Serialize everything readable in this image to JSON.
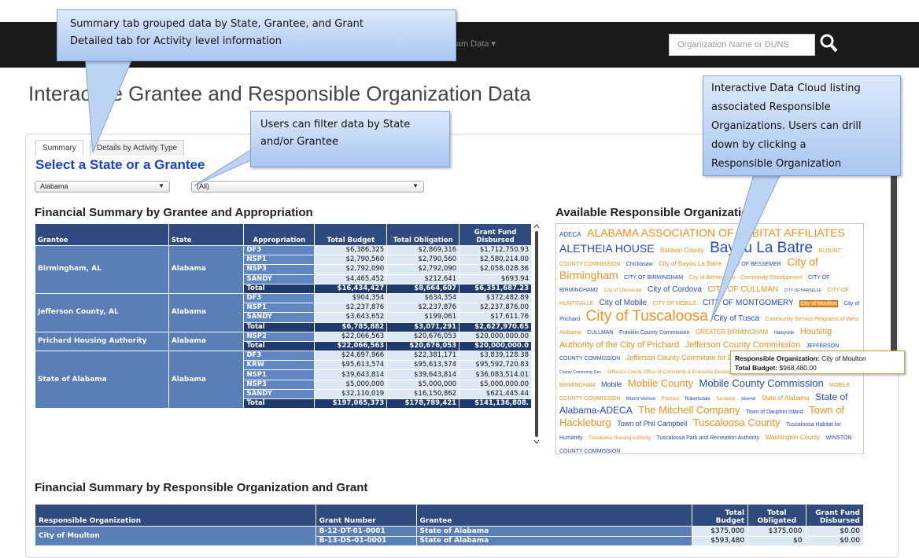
{
  "header": {
    "nav_label": "gram Data",
    "search_placeholder": "Organization Name or DUNS"
  },
  "page_title": "Interactive Grantee and Responsible Organization Data",
  "tabs": [
    {
      "label": "Summary"
    },
    {
      "label": "Details by Activity Type"
    }
  ],
  "select_heading": "Select a State or a Grantee",
  "filters": {
    "state": "Alabama",
    "grantee": "(All)"
  },
  "financial_title": "Financial Summary by Grantee and Appropriation",
  "fin_headers": {
    "grantee": "Grantee",
    "state": "State",
    "appropriation": "Appropriation",
    "total_budget": "Total Budget",
    "total_obligation": "Total Obligation",
    "grant_fund": "Grant Fund Disbursed"
  },
  "fin_rows": [
    {
      "ap": "DF3",
      "tb": "$6,386,325",
      "to": "$2,869,316",
      "gf": "$1,712,750.93"
    },
    {
      "ap": "NSP1",
      "tb": "$2,790,560",
      "to": "$2,790,560",
      "gf": "$2,580,214.00"
    },
    {
      "ap": "NSP3",
      "tb": "$2,792,090",
      "to": "$2,792,090",
      "gf": "$2,058,028.36"
    },
    {
      "ap": "SANDY",
      "tb": "$4,465,452",
      "to": "$212,641",
      "gf": "$693.94"
    },
    {
      "ap": "Total",
      "tb": "$16,434,427",
      "to": "$8,664,607",
      "gf": "$6,351,687.23"
    },
    {
      "ap": "DF3",
      "tb": "$904,354",
      "to": "$634,354",
      "gf": "$372,482.89"
    },
    {
      "ap": "NSP1",
      "tb": "$2,237,876",
      "to": "$2,237,876",
      "gf": "$2,237,876.00"
    },
    {
      "ap": "SANDY",
      "tb": "$3,643,652",
      "to": "$199,061",
      "gf": "$17,611.76"
    },
    {
      "ap": "Total",
      "tb": "$6,785,882",
      "to": "$3,071,291",
      "gf": "$2,627,970.65"
    },
    {
      "ap": "NSP2",
      "tb": "$22,066,563",
      "to": "$20,676,053",
      "gf": "$20,000,000.00"
    },
    {
      "ap": "Total",
      "tb": "$22,066,563",
      "to": "$20,676,053",
      "gf": "$20,000,000.0"
    },
    {
      "ap": "DF3",
      "tb": "$24,697,966",
      "to": "$22,381,171",
      "gf": "$3,839,128.38"
    },
    {
      "ap": "KRW",
      "tb": "$95,613,574",
      "to": "$95,613,574",
      "gf": "$95,592,720.83"
    },
    {
      "ap": "NSP1",
      "tb": "$39,643,814",
      "to": "$39,643,814",
      "gf": "$36,083,514.01"
    },
    {
      "ap": "NSP3",
      "tb": "$5,000,000",
      "to": "$5,000,000",
      "gf": "$5,000,000.00"
    },
    {
      "ap": "SANDY",
      "tb": "$32,110,019",
      "to": "$16,150,862",
      "gf": "$621,445.44"
    },
    {
      "ap": "Total",
      "tb": "$197,065,373",
      "to": "$178,789,421",
      "gf": "$141,136,808."
    }
  ],
  "fin_groups": [
    {
      "grantee": "Birmingham, AL",
      "state": "Alabama"
    },
    {
      "grantee": "Jefferson County, AL",
      "state": "Alabama"
    },
    {
      "grantee": "Prichard Housing Authority",
      "state": "Alabama"
    },
    {
      "grantee": "State of Alabama",
      "state": "Alabama"
    }
  ],
  "cloud_title": "Available Responsible Organizations",
  "cloud_words": [
    {
      "t": "ADECA",
      "s": 8,
      "c": "b"
    },
    {
      "t": "ALABAMA ASSOCIATION OF HABITAT AFFILIATES",
      "s": 14,
      "c": "o"
    },
    {
      "t": "ALETHEIA HOUSE",
      "s": 14,
      "c": "b"
    },
    {
      "t": "Baldwin County",
      "s": 8,
      "c": "o"
    },
    {
      "t": "Bayou La Batre",
      "s": 19,
      "c": "b"
    },
    {
      "t": "BLOUNT COUNTY COMMISSION",
      "s": 7,
      "c": "o"
    },
    {
      "t": "Chickasaw",
      "s": 7,
      "c": "b"
    },
    {
      "t": "City of Bayou La Batre",
      "s": 8,
      "c": "o"
    },
    {
      "t": "CITY OF BESSEMER",
      "s": 7,
      "c": "b"
    },
    {
      "t": "City of Birmingham",
      "s": 14,
      "c": "o"
    },
    {
      "t": "CITY OF BIRMINGHAM",
      "s": 7,
      "c": "b"
    },
    {
      "t": "City of Birmingham - Community Development",
      "s": 7,
      "c": "o"
    },
    {
      "t": "CITY OF BIRMINGHAM2",
      "s": 7,
      "c": "b"
    },
    {
      "t": "City of Chickasaw",
      "s": 6,
      "c": "o"
    },
    {
      "t": "City of Cordova",
      "s": 10,
      "c": "b"
    },
    {
      "t": "CITY OF CULLMAN",
      "s": 10,
      "c": "o"
    },
    {
      "t": "CITY OF HARSELLE",
      "s": 5,
      "c": "b"
    },
    {
      "t": "CITY OF HUNTSVILLE",
      "s": 7,
      "c": "o"
    },
    {
      "t": "City of Mobile",
      "s": 10,
      "c": "b"
    },
    {
      "t": "CITY OF MOBILE",
      "s": 7,
      "c": "o"
    },
    {
      "t": "CITY OF MONTGOMERY",
      "s": 10,
      "c": "b"
    },
    {
      "t": "City of Moulton",
      "s": 7,
      "c": "hl"
    },
    {
      "t": "City of Prichard",
      "s": 7,
      "c": "b"
    },
    {
      "t": "City of Tuscaloosa",
      "s": 19,
      "c": "o"
    },
    {
      "t": "City of Tusca",
      "s": 10,
      "c": "b"
    },
    {
      "t": "Community Service Programs of West Alabama",
      "s": 7,
      "c": "o"
    },
    {
      "t": "CULLMAN",
      "s": 7,
      "c": "b"
    },
    {
      "t": "Franklin County Commission",
      "s": 7,
      "c": "b"
    },
    {
      "t": "GREATER BIRMINGHAM",
      "s": 8,
      "c": "o"
    },
    {
      "t": "Haleyville",
      "s": 6,
      "c": "b"
    },
    {
      "t": "Housing Authority of the City of Prichard",
      "s": 11,
      "c": "o"
    },
    {
      "t": "Jefferson County Commission",
      "s": 11,
      "c": "o"
    },
    {
      "t": "JEFFERSON COUNTY COMMISSION",
      "s": 7,
      "c": "b"
    },
    {
      "t": "Jefferson County Committee for Economic Opportunity (JCCEO)",
      "s": 9,
      "c": "o"
    },
    {
      "t": "Jefferson County Community Dev",
      "s": 5,
      "c": "b"
    },
    {
      "t": "Jefferson County Office of Community & Economic Development",
      "s": 6,
      "c": "o"
    },
    {
      "t": "Marion County Commission",
      "s": 7,
      "c": "b"
    },
    {
      "t": "MISSION BIRMINGHAM",
      "s": 7,
      "c": "o"
    },
    {
      "t": "Mobile",
      "s": 9,
      "c": "b"
    },
    {
      "t": "Mobile County",
      "s": 13,
      "c": "o"
    },
    {
      "t": "Mobile County Commission",
      "s": 13,
      "c": "b"
    },
    {
      "t": "MOBILE COUNTY COMMISSION",
      "s": 7,
      "c": "o"
    },
    {
      "t": "Mount Vernon",
      "s": 6,
      "c": "b"
    },
    {
      "t": "Prichard",
      "s": 6,
      "c": "o"
    },
    {
      "t": "Robertsdale",
      "s": 6,
      "c": "b"
    },
    {
      "t": "Saraland",
      "s": 6,
      "c": "o"
    },
    {
      "t": "Silverhill",
      "s": 5,
      "c": "b"
    },
    {
      "t": "State of Alabama",
      "s": 8,
      "c": "o"
    },
    {
      "t": "State of Alabama-ADECA",
      "s": 12,
      "c": "b"
    },
    {
      "t": "The Mitchell Company",
      "s": 13,
      "c": "o"
    },
    {
      "t": "Town of Dauphin Island",
      "s": 7,
      "c": "b"
    },
    {
      "t": "Town of Hackleburg",
      "s": 13,
      "c": "o"
    },
    {
      "t": "Town of Phil Campbell",
      "s": 9,
      "c": "b"
    },
    {
      "t": "Tuscaloosa County",
      "s": 13,
      "c": "o"
    },
    {
      "t": "Tuscaloosa Habitat for Humanity",
      "s": 7,
      "c": "b"
    },
    {
      "t": "Tuscaloosa Housing Authority",
      "s": 6,
      "c": "o"
    },
    {
      "t": "Tuscaloosa Park and Recreation Authority",
      "s": 7,
      "c": "b"
    },
    {
      "t": "Washington County",
      "s": 8,
      "c": "o"
    },
    {
      "t": "WINSTON COUNTY COMMISSION",
      "s": 7,
      "c": "b"
    }
  ],
  "tooltip": {
    "org_label": "Responsible Organization:",
    "org_value": "City of Moulton",
    "budget_label": "Total Budget:",
    "budget_value": "$968,480.00"
  },
  "resp_title": "Financial Summary by Responsible Organization and Grant",
  "resp_headers": {
    "org": "Responsible Organization",
    "grant_number": "Grant Number",
    "grantee": "Grantee",
    "total_budget": "Total Budget",
    "total_obligated": "Total Obligated",
    "grant_fund": "Grant Fund Disbursed"
  },
  "resp_org": "City of Moulton",
  "resp_rows": [
    {
      "gn": "B-12-DT-01-0001",
      "grantee": "State of Alabama",
      "tb": "$375,000",
      "to": "$375,000",
      "gf": "$0.00"
    },
    {
      "gn": "B-13-DS-01-0001",
      "grantee": "State of Alabama",
      "tb": "$593,480",
      "to": "$0",
      "gf": "$0.00"
    }
  ],
  "callouts": {
    "c1": [
      "Summary tab grouped data by State, Grantee, and Grant",
      "Detailed tab for Activity level information"
    ],
    "c2": [
      "Users can filter data by State",
      "and/or Grantee"
    ],
    "c3": [
      "Interactive Data Cloud listing",
      "associated Responsible",
      "Organizations. Users can drill",
      "down by clicking  a",
      "Responsible Organization"
    ]
  },
  "colors": {
    "header_blue": "#2e4a7e",
    "cell_blue": "#dde8f5",
    "accent_blue": "#1a3fd6",
    "cloud_orange": "#f0901e",
    "cloud_blue": "#2346c8"
  }
}
